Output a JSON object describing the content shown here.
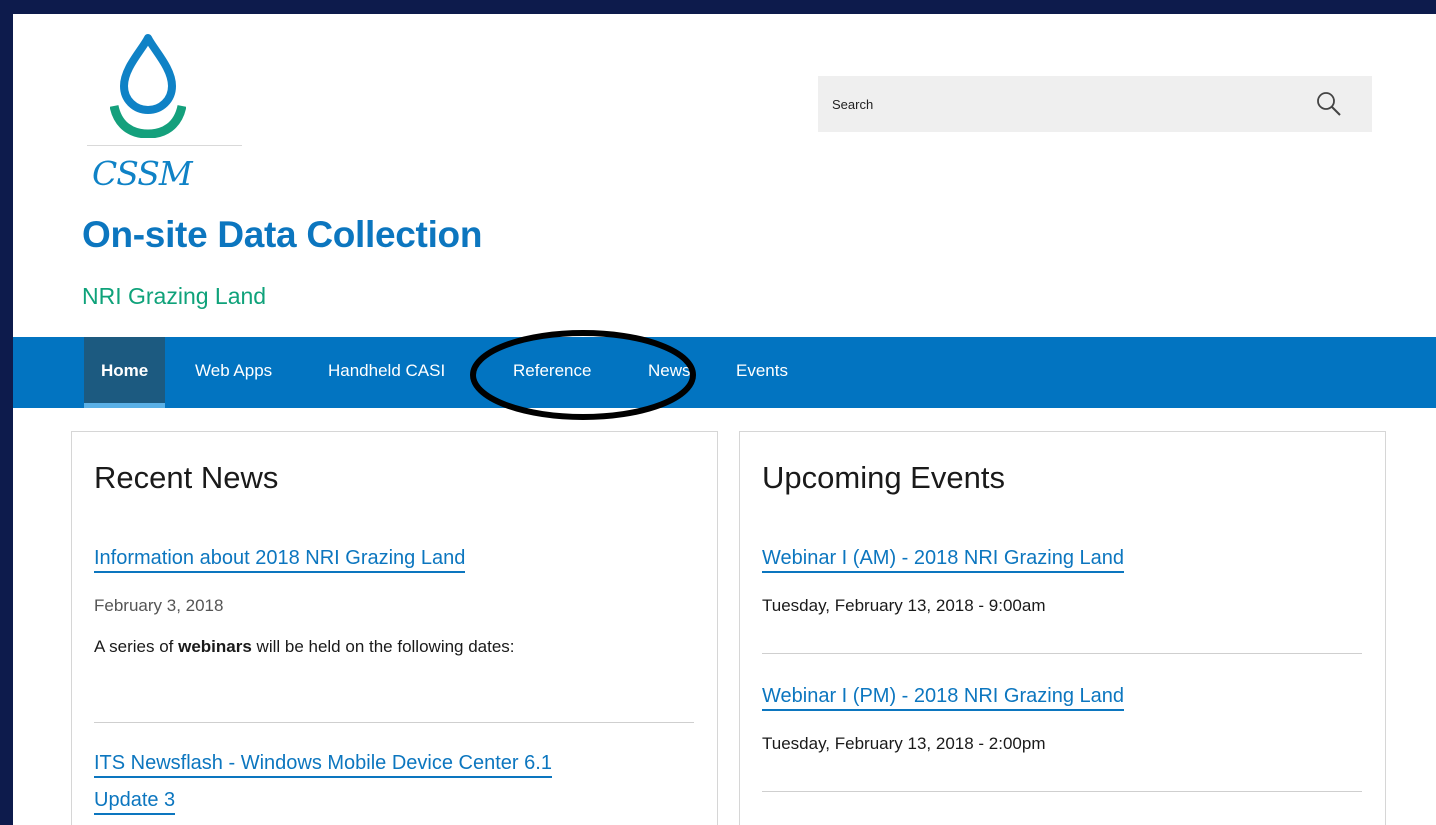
{
  "site": {
    "logo_text": "CSSM",
    "title": "On-site Data Collection",
    "subtitle": "NRI Grazing Land"
  },
  "search": {
    "placeholder": "Search",
    "icon": "search-icon"
  },
  "nav": {
    "items": [
      {
        "label": "Home",
        "active": true
      },
      {
        "label": "Web Apps",
        "active": false
      },
      {
        "label": "Handheld CASI",
        "active": false
      },
      {
        "label": "Reference",
        "active": false
      },
      {
        "label": "News",
        "active": false
      },
      {
        "label": "Events",
        "active": false
      }
    ]
  },
  "news": {
    "heading": "Recent News",
    "items": [
      {
        "title": "Information about 2018 NRI Grazing Land",
        "date": "February 3, 2018",
        "summary_pre": "A series of ",
        "summary_bold": "webinars",
        "summary_post": " will be held on the following dates:"
      },
      {
        "title_line1": "ITS Newsflash - Windows Mobile Device Center 6.1",
        "title_line2": "Update 3"
      }
    ]
  },
  "events": {
    "heading": "Upcoming Events",
    "items": [
      {
        "title": "Webinar I (AM) - 2018 NRI Grazing Land",
        "date": "Tuesday, February 13, 2018 - 9:00am"
      },
      {
        "title": "Webinar I (PM) - 2018 NRI Grazing Land",
        "date": "Tuesday, February 13, 2018 - 2:00pm"
      }
    ]
  },
  "colors": {
    "brand_blue": "#0c76bf",
    "nav_bg": "#0274c1",
    "nav_active_bg": "#1c5a80",
    "subtitle_green": "#0fa27a",
    "frame": "#0d1b4c"
  }
}
